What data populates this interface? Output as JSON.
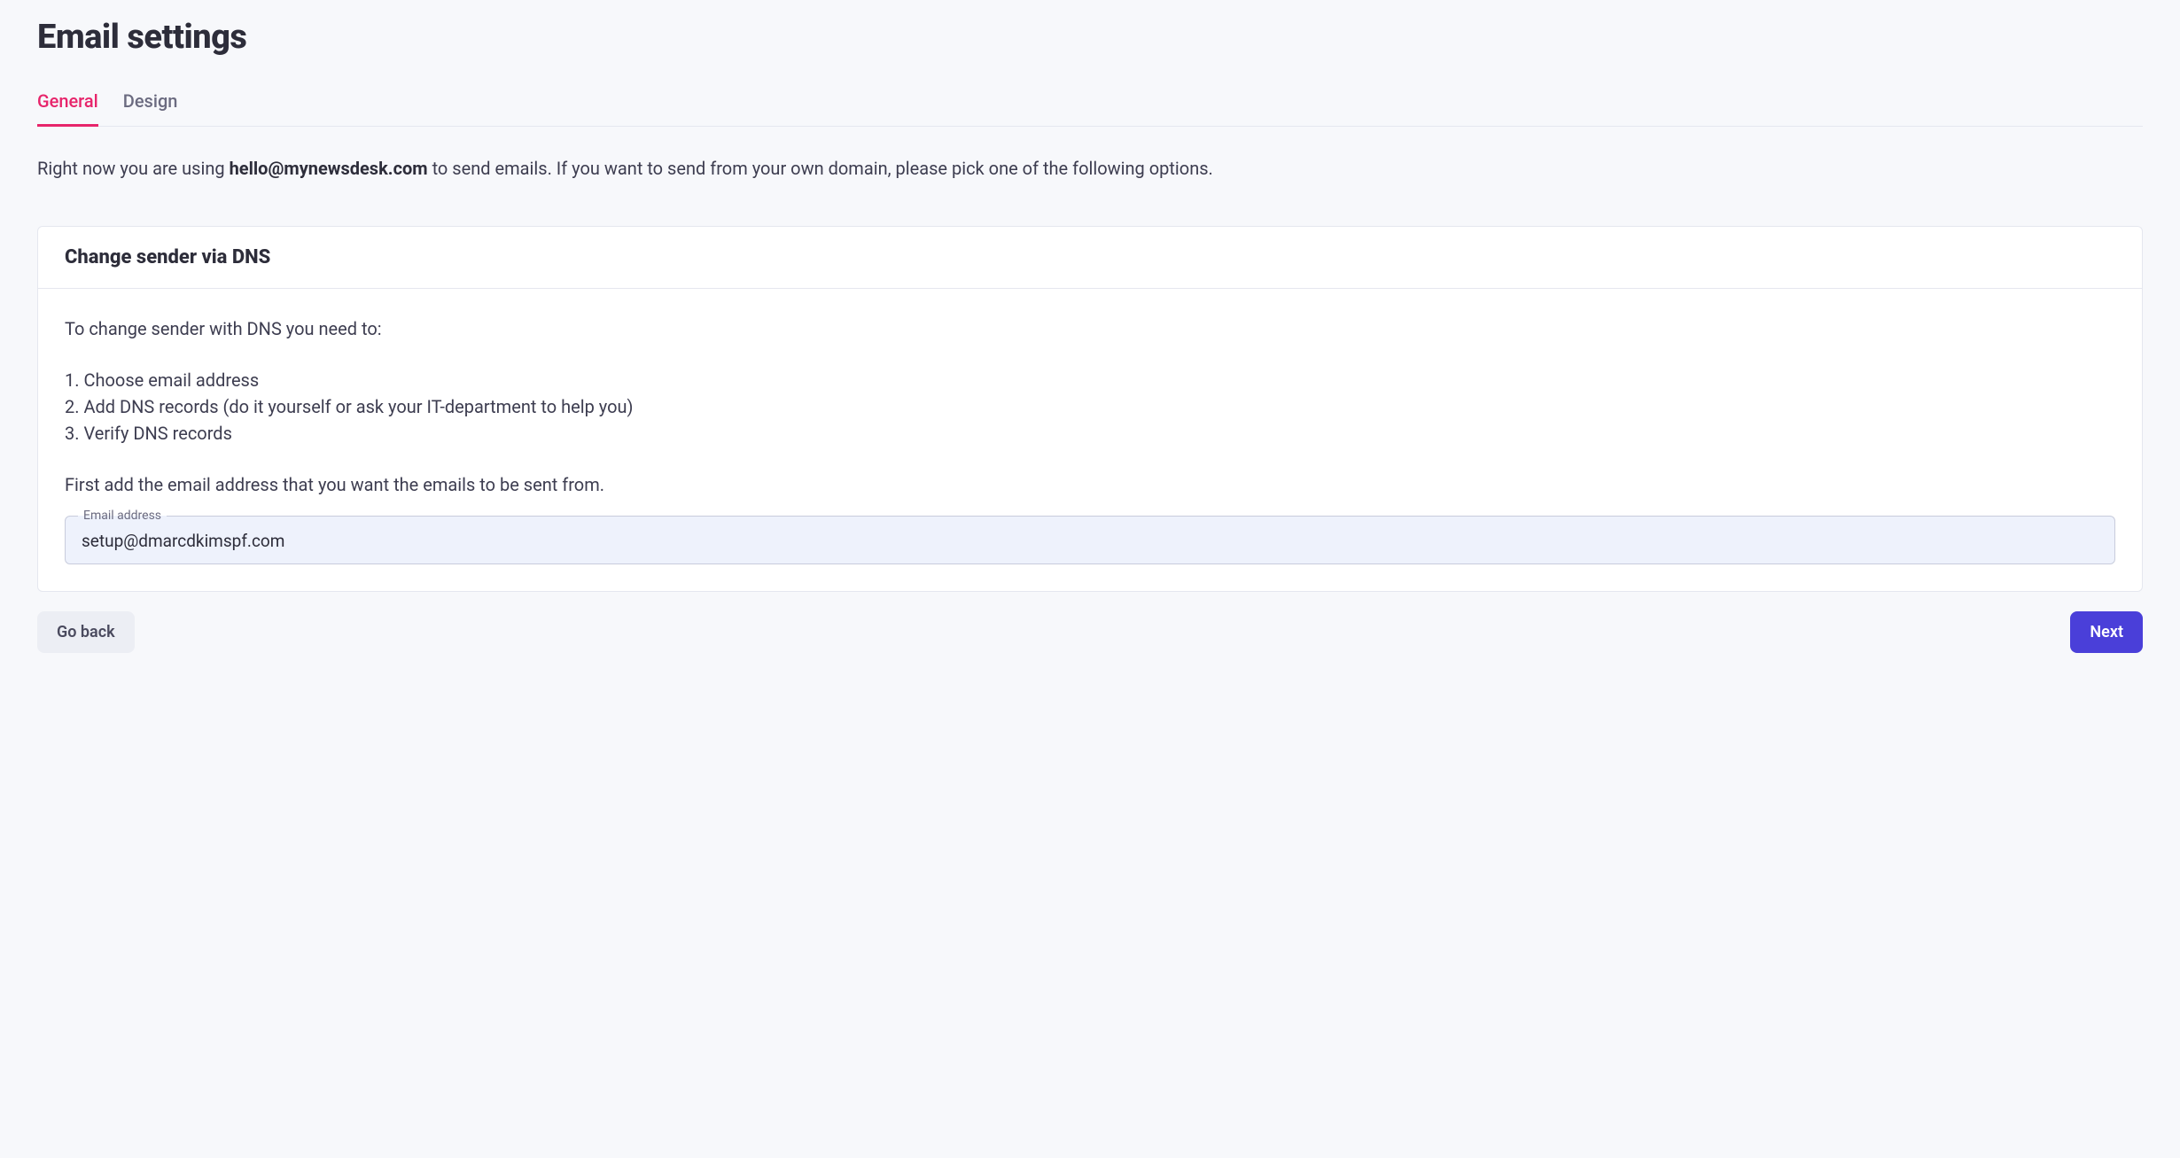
{
  "page": {
    "title": "Email settings"
  },
  "tabs": {
    "general": "General",
    "design": "Design"
  },
  "intro": {
    "prefix": "Right now you are using ",
    "email": "hello@mynewsdesk.com",
    "suffix": " to send emails. If you want to send from your own domain, please pick one of the following options."
  },
  "card": {
    "title": "Change sender via DNS",
    "lead": "To change sender with DNS you need to:",
    "steps": [
      "1. Choose email address",
      "2. Add DNS records (do it yourself or ask your IT-department to help you)",
      "3. Verify DNS records"
    ],
    "instruction": "First add the email address that you want the emails to be sent from.",
    "input_label": "Email address",
    "input_value": "setup@dmarcdkimspf.com"
  },
  "footer": {
    "back": "Go back",
    "next": "Next"
  }
}
